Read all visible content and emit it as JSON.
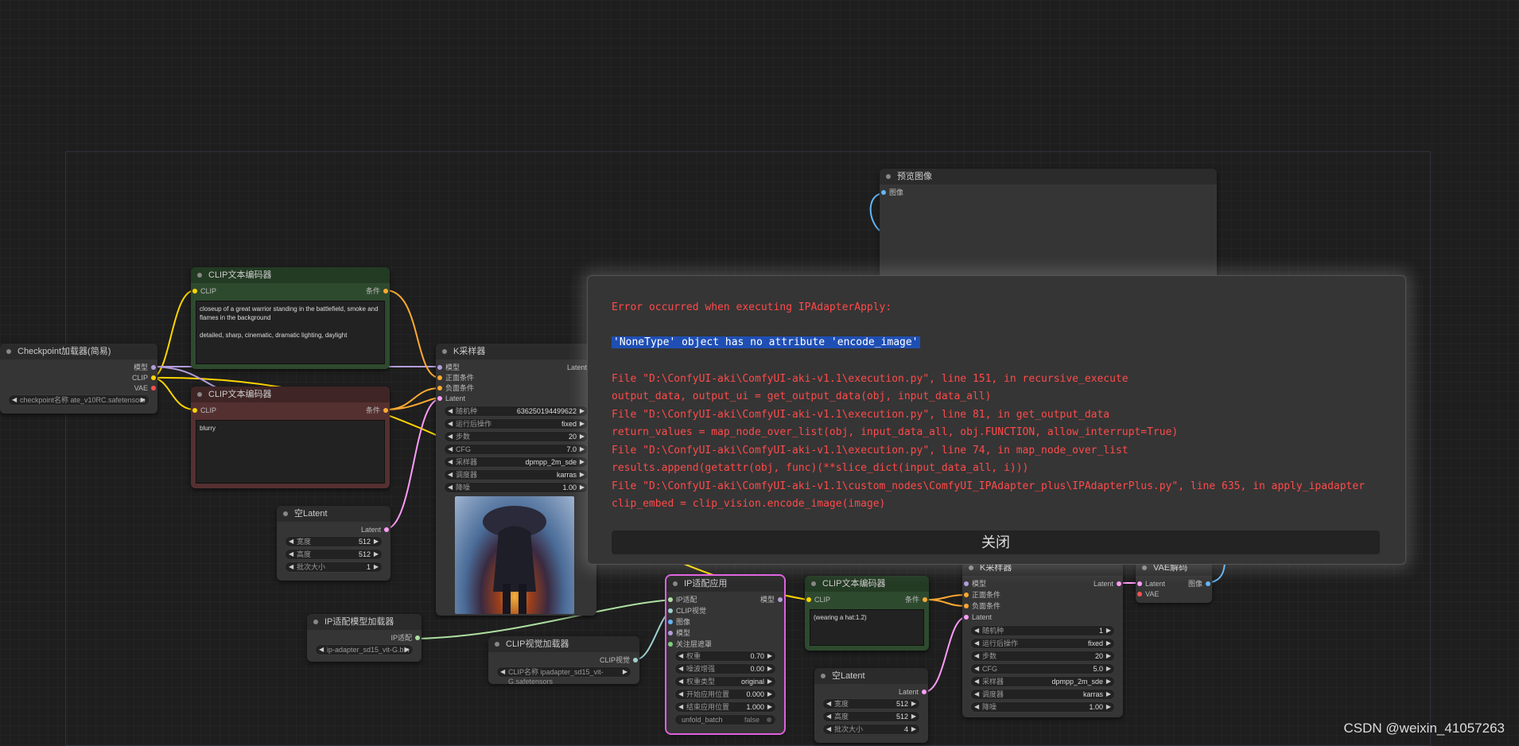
{
  "colors": {
    "background": "#1e1e1e",
    "error_text": "#ff4a4a",
    "highlight": "#1f4fb4",
    "clip_wire": "#ffd500",
    "model_wire": "#b39ddb",
    "cond_wire": "#ffa931",
    "latent_wire": "#ff9cf9",
    "image_wire": "#64b5f6",
    "selected_outline": "#e060e0"
  },
  "nodes": {
    "checkpoint": {
      "title": "Checkpoint加载器(简易)",
      "outputs": [
        "模型",
        "CLIP",
        "VAE"
      ],
      "ckpt_name": "checkpoint名称 ate_v10RC.safetensors"
    },
    "clip_pos": {
      "title": "CLIP文本编码器",
      "input": "CLIP",
      "output": "条件",
      "text": "closeup of a great warrior standing in the battlefield, smoke and flames in the background\n\ndetailed, sharp, cinematic, dramatic lighting, daylight"
    },
    "clip_neg": {
      "title": "CLIP文本编码器",
      "input": "CLIP",
      "output": "条件",
      "text": "blurry"
    },
    "empty_latent1": {
      "title": "空Latent",
      "output": "Latent",
      "widgets": [
        {
          "label": "宽度",
          "value": "512"
        },
        {
          "label": "高度",
          "value": "512"
        },
        {
          "label": "批次大小",
          "value": "1"
        }
      ]
    },
    "ksampler1": {
      "title": "K采样器",
      "inputs": [
        "模型",
        "正面条件",
        "负面条件",
        "Latent"
      ],
      "output": "Latent",
      "widgets": [
        {
          "label": "随机种",
          "value": "636250194499622"
        },
        {
          "label": "运行后操作",
          "value": "fixed"
        },
        {
          "label": "步数",
          "value": "20"
        },
        {
          "label": "CFG",
          "value": "7.0"
        },
        {
          "label": "采样器",
          "value": "dpmpp_2m_sde"
        },
        {
          "label": "调度器",
          "value": "karras"
        },
        {
          "label": "降噪",
          "value": "1.00"
        }
      ]
    },
    "ipadapter_loader": {
      "title": "IP适配模型加载器",
      "output": "IP适配",
      "model_name": "ip-adapter_sd15_vit-G.bin"
    },
    "clip_vision_loader": {
      "title": "CLIP视觉加载器",
      "output": "CLIP视觉",
      "clip_name": "CLIP名称 ipadapter_sd15_vit-G.safetensors"
    },
    "ipadapter_apply": {
      "title": "IP适配应用",
      "inputs": [
        "IP适配",
        "CLIP视觉",
        "图像",
        "模型",
        "关注层遮罩"
      ],
      "output": "模型",
      "widgets": [
        {
          "label": "权重",
          "value": "0.70"
        },
        {
          "label": "噪波增强",
          "value": "0.00"
        },
        {
          "label": "权重类型",
          "value": "original"
        },
        {
          "label": "开始应用位置",
          "value": "0.000"
        },
        {
          "label": "结束应用位置",
          "value": "1.000"
        }
      ],
      "toggle": {
        "label": "unfold_batch",
        "value": "false"
      }
    },
    "clip_text3": {
      "title": "CLIP文本编码器",
      "input": "CLIP",
      "output": "条件",
      "text": "(wearing a hat:1.2)"
    },
    "empty_latent2": {
      "title": "空Latent",
      "output": "Latent",
      "widgets": [
        {
          "label": "宽度",
          "value": "512"
        },
        {
          "label": "高度",
          "value": "512"
        },
        {
          "label": "批次大小",
          "value": "4"
        }
      ]
    },
    "ksampler2": {
      "title": "K采样器",
      "inputs": [
        "模型",
        "正面条件",
        "负面条件",
        "Latent"
      ],
      "output": "Latent",
      "widgets": [
        {
          "label": "随机种",
          "value": "1"
        },
        {
          "label": "运行后操作",
          "value": "fixed"
        },
        {
          "label": "步数",
          "value": "20"
        },
        {
          "label": "CFG",
          "value": "5.0"
        },
        {
          "label": "采样器",
          "value": "dpmpp_2m_sde"
        },
        {
          "label": "调度器",
          "value": "karras"
        },
        {
          "label": "降噪",
          "value": "1.00"
        }
      ]
    },
    "vae_decode": {
      "title": "VAE解码",
      "inputs": [
        "Latent",
        "VAE"
      ],
      "output": "图像"
    },
    "preview": {
      "title": "预览图像",
      "input": "图像"
    }
  },
  "error_dialog": {
    "heading": "Error occurred when executing IPAdapterApply:",
    "message": "'NoneType' object has no attribute 'encode_image'",
    "traceback": [
      "File \"D:\\ConfyUI-aki\\ComfyUI-aki-v1.1\\execution.py\", line 151, in recursive_execute",
      "output_data, output_ui = get_output_data(obj, input_data_all)",
      "File \"D:\\ConfyUI-aki\\ComfyUI-aki-v1.1\\execution.py\", line 81, in get_output_data",
      "return_values = map_node_over_list(obj, input_data_all, obj.FUNCTION, allow_interrupt=True)",
      "File \"D:\\ConfyUI-aki\\ComfyUI-aki-v1.1\\execution.py\", line 74, in map_node_over_list",
      "results.append(getattr(obj, func)(**slice_dict(input_data_all, i)))",
      "File \"D:\\ConfyUI-aki\\ComfyUI-aki-v1.1\\custom_nodes\\ComfyUI_IPAdapter_plus\\IPAdapterPlus.py\", line 635, in apply_ipadapter",
      "clip_embed = clip_vision.encode_image(image)"
    ],
    "close_label": "关闭"
  },
  "watermark": "CSDN @weixin_41057263"
}
